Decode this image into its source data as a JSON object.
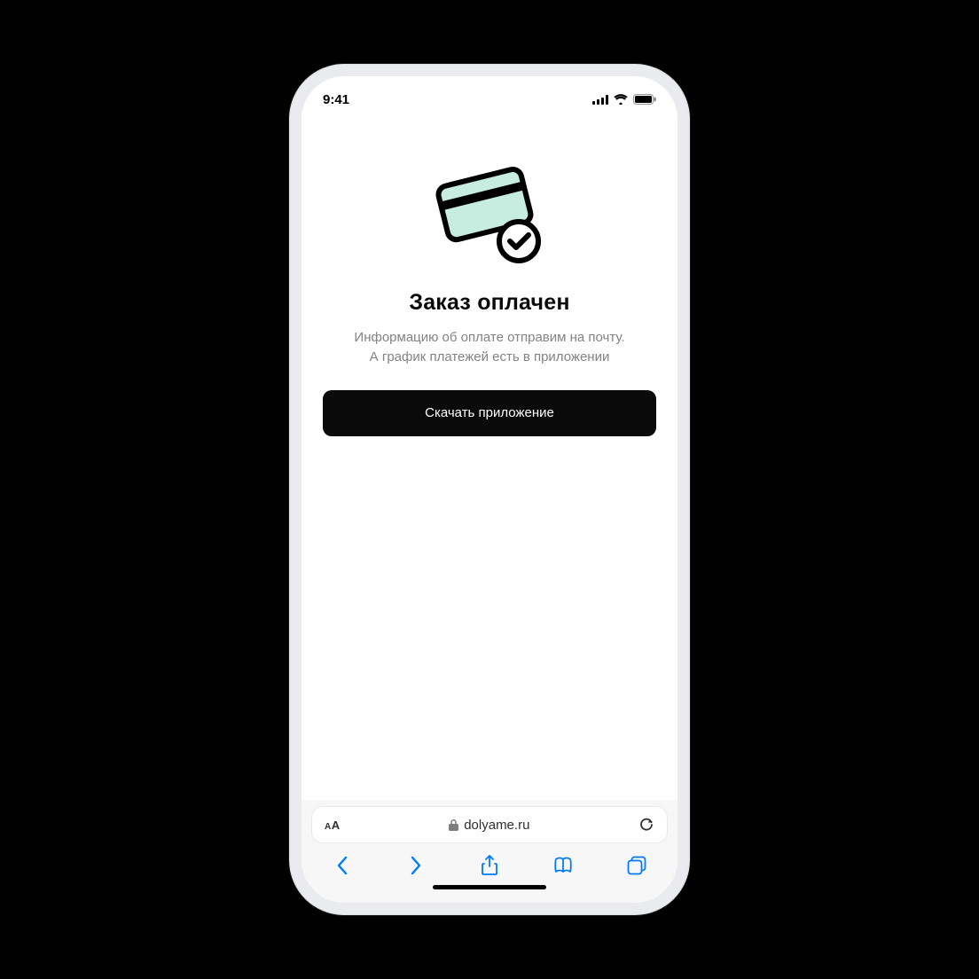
{
  "status": {
    "time": "9:41"
  },
  "page": {
    "title": "Заказ оплачен",
    "subtitle_line1": "Информацию об оплате отправим на почту.",
    "subtitle_line2": "А график платежей есть в приложении",
    "cta_label": "Скачать приложение"
  },
  "browser": {
    "text_size_label": "A",
    "domain": "dolyame.ru"
  }
}
